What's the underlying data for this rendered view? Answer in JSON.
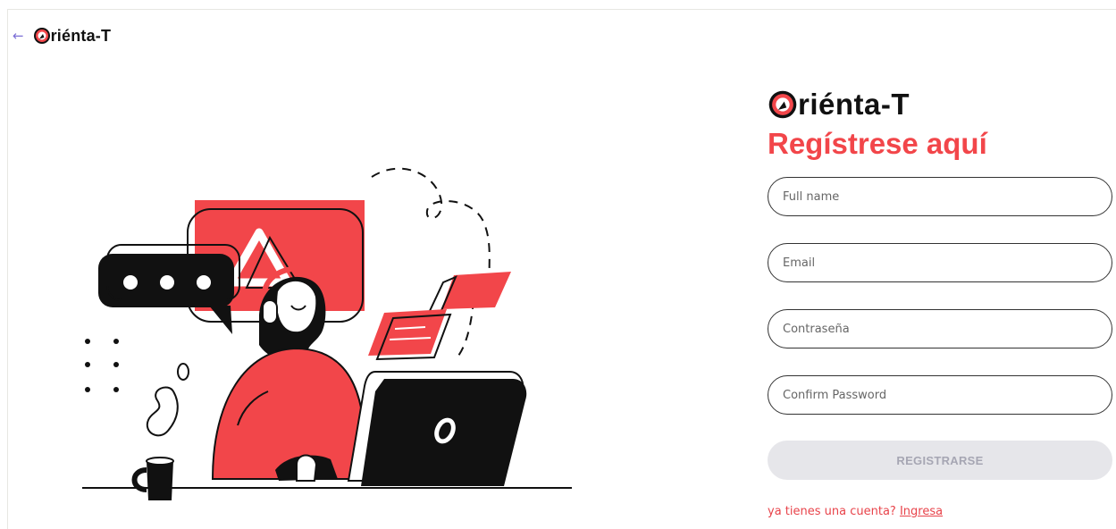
{
  "header": {
    "back_icon": "arrow-left-icon",
    "logo_text": "riénta-T",
    "logo_icon": "compass-o-icon"
  },
  "illustration": {
    "subject": "woman-with-headset-at-laptop"
  },
  "form": {
    "logo_text": "riénta-T",
    "heading": "Regístrese aquí",
    "fields": {
      "full_name": {
        "placeholder": "Full name",
        "value": ""
      },
      "email": {
        "placeholder": "Email",
        "value": ""
      },
      "password": {
        "placeholder": "Contraseña",
        "value": ""
      },
      "confirm_password": {
        "placeholder": "Confirm Password",
        "value": ""
      }
    },
    "submit_label": "REGISTRARSE",
    "login_prompt": "ya tienes una cuenta?",
    "login_link": "Ingresa"
  },
  "colors": {
    "accent": "#f2464a",
    "text": "#111111",
    "back_arrow": "#7c6fd6",
    "button_disabled_bg": "#e6e6ea",
    "button_disabled_text": "#a6a6b3"
  }
}
